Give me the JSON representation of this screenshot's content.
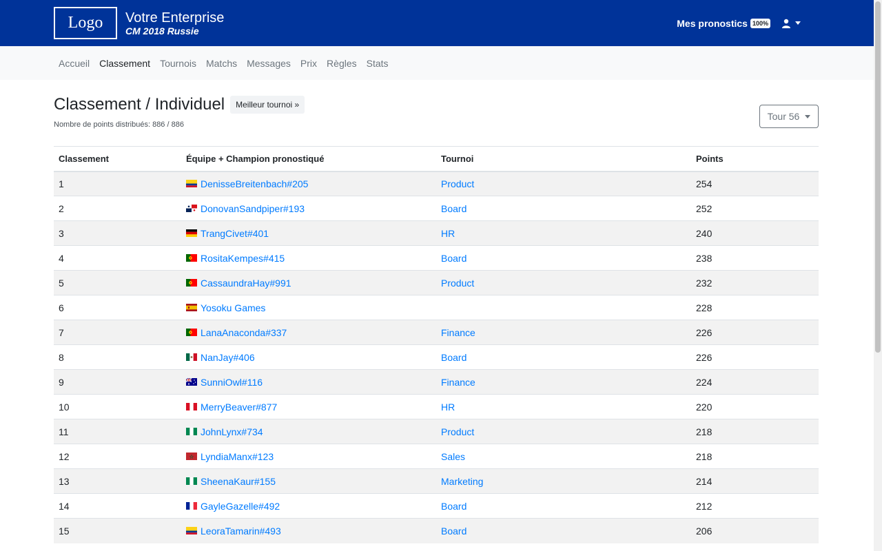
{
  "header": {
    "logo": "Logo",
    "brand_title": "Votre Enterprise",
    "brand_subtitle": "CM 2018 Russie",
    "pronostics_label": "Mes pronostics",
    "pronostics_badge": "100%",
    "user_icon": "user-icon"
  },
  "nav": {
    "items": [
      "Accueil",
      "Classement",
      "Tournois",
      "Matchs",
      "Messages",
      "Prix",
      "Règles",
      "Stats"
    ],
    "active": "Classement"
  },
  "page": {
    "title": "Classement / Individuel",
    "best_button": "Meilleur tournoi »",
    "points_note": "Nombre de points distribués: 886 / 886",
    "tour_select": "Tour 56"
  },
  "table": {
    "headers": [
      "Classement",
      "Équipe + Champion pronostiqué",
      "Tournoi",
      "Points"
    ],
    "rows": [
      {
        "rank": "1",
        "flag": "colombia",
        "name": "DenisseBreitenbach#205",
        "tournoi": "Product",
        "points": "254"
      },
      {
        "rank": "2",
        "flag": "panama",
        "name": "DonovanSandpiper#193",
        "tournoi": "Board",
        "points": "252"
      },
      {
        "rank": "3",
        "flag": "germany",
        "name": "TrangCivet#401",
        "tournoi": "HR",
        "points": "240"
      },
      {
        "rank": "4",
        "flag": "portugal",
        "name": "RositaKempes#415",
        "tournoi": "Board",
        "points": "238"
      },
      {
        "rank": "5",
        "flag": "portugal",
        "name": "CassaundraHay#991",
        "tournoi": "Product",
        "points": "232"
      },
      {
        "rank": "6",
        "flag": "spain",
        "name": "Yosoku Games",
        "tournoi": "",
        "points": "228"
      },
      {
        "rank": "7",
        "flag": "portugal",
        "name": "LanaAnaconda#337",
        "tournoi": "Finance",
        "points": "226"
      },
      {
        "rank": "8",
        "flag": "mexico",
        "name": "NanJay#406",
        "tournoi": "Board",
        "points": "226"
      },
      {
        "rank": "9",
        "flag": "australia",
        "name": "SunniOwl#116",
        "tournoi": "Finance",
        "points": "224"
      },
      {
        "rank": "10",
        "flag": "peru",
        "name": "MerryBeaver#877",
        "tournoi": "HR",
        "points": "220"
      },
      {
        "rank": "11",
        "flag": "nigeria",
        "name": "JohnLynx#734",
        "tournoi": "Product",
        "points": "218"
      },
      {
        "rank": "12",
        "flag": "morocco",
        "name": "LyndiaManx#123",
        "tournoi": "Sales",
        "points": "218"
      },
      {
        "rank": "13",
        "flag": "nigeria",
        "name": "SheenaKaur#155",
        "tournoi": "Marketing",
        "points": "214"
      },
      {
        "rank": "14",
        "flag": "france",
        "name": "GayleGazelle#492",
        "tournoi": "Board",
        "points": "212"
      },
      {
        "rank": "15",
        "flag": "colombia",
        "name": "LeoraTamarin#493",
        "tournoi": "Board",
        "points": "206"
      }
    ]
  },
  "colors": {
    "header_bg": "#003399",
    "link": "#007bff"
  }
}
